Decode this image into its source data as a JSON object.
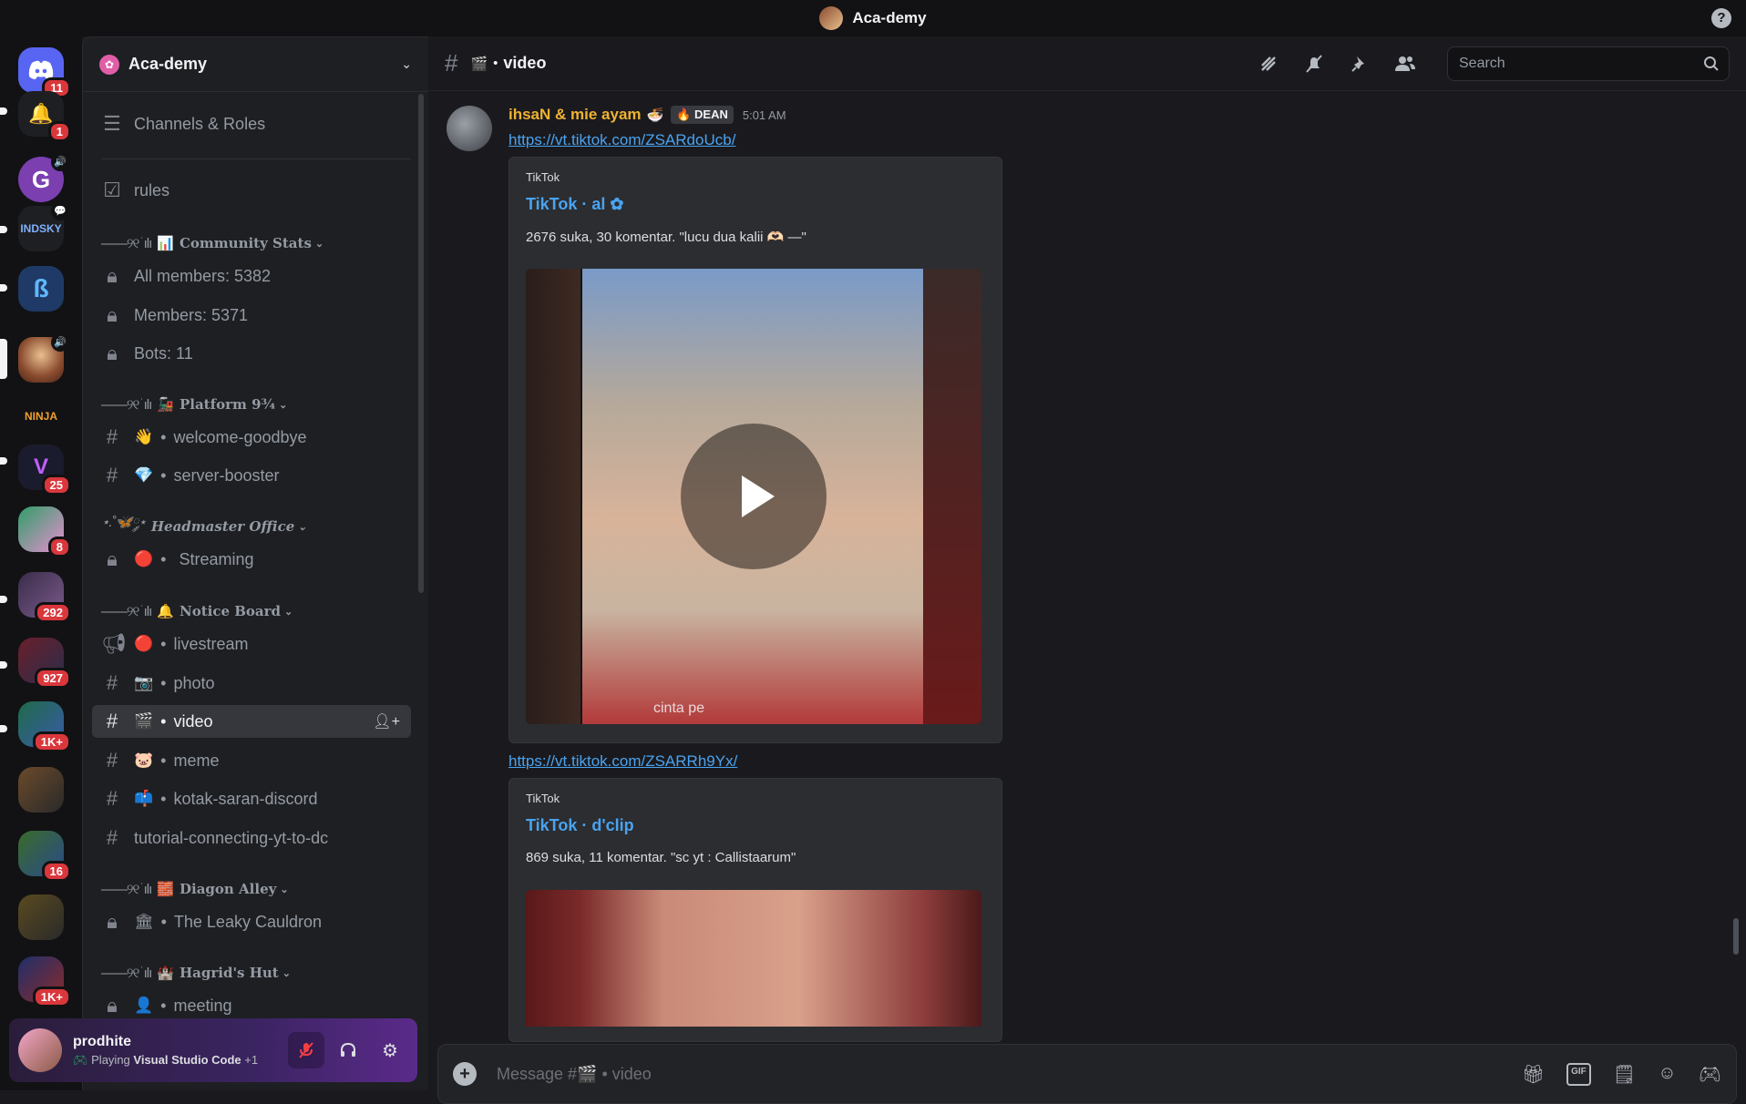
{
  "window": {
    "title": "Aca-demy",
    "help_icon": "?"
  },
  "rail": {
    "servers": [
      {
        "name": "discord-home",
        "badge": "11",
        "color": "#5865f2"
      },
      {
        "name": "notifications",
        "badge": "1",
        "color": "#2b2d31"
      },
      {
        "name": "server-g",
        "badge": "",
        "color": "#7b3fb0"
      },
      {
        "name": "server-indosky",
        "badge": "",
        "color": "#1e1f22"
      },
      {
        "name": "server-b",
        "badge": "",
        "color": "#1f3a66"
      },
      {
        "name": "server-aca-demy",
        "badge": "",
        "color": "#8a4b2f"
      },
      {
        "name": "server-ninja",
        "badge": "",
        "color": "#121214"
      },
      {
        "name": "server-v",
        "badge": "25",
        "color": "#1b1b2e"
      },
      {
        "name": "server-anime",
        "badge": "8",
        "color": "#2f9e68"
      },
      {
        "name": "folder-1",
        "badge": "292",
        "color": "#3a2d4a"
      },
      {
        "name": "folder-2",
        "badge": "927",
        "color": "#6a1f2b"
      },
      {
        "name": "folder-3",
        "badge": "1K+",
        "color": "#1f6b4a"
      },
      {
        "name": "folder-4",
        "badge": "",
        "color": "#6b4a2a"
      },
      {
        "name": "folder-5",
        "badge": "16",
        "color": "#3a6b2a"
      },
      {
        "name": "folder-6",
        "badge": "",
        "color": "#5a4a1f"
      },
      {
        "name": "folder-7",
        "badge": "1K+",
        "color": "#1f2f6b"
      },
      {
        "name": "folder-8",
        "badge": "",
        "color": "#6b3aa8"
      }
    ]
  },
  "sidebar": {
    "guild_name": "Aca-demy",
    "channels_roles": "Channels & Roles",
    "rules": "rules",
    "categories": {
      "community": {
        "ornament": "——୨୧ ׂ ılı",
        "emoji": "📊",
        "name": "Community Stats"
      },
      "platform": {
        "ornament": "——୨୧ ׂ ılı",
        "emoji": "🚂",
        "name": "Platform 9¾"
      },
      "headmaster": {
        "ornament": "⋆.˚🦋༘⋆",
        "emoji": "",
        "name": "Headmaster Office"
      },
      "notice": {
        "ornament": "——୨୧ ׂ ılı",
        "emoji": "🔔",
        "name": "Notice Board"
      },
      "diagon": {
        "ornament": "——୨୧ ׂ ılı",
        "emoji": "🧱",
        "name": "Diagon Alley"
      },
      "hagrid": {
        "ornament": "——୨୧ ׂ ılı",
        "emoji": "🏰",
        "name": "Hagrid's Hut"
      }
    },
    "channels": {
      "all_members": "All members: 5382",
      "members": "Members: 5371",
      "bots": "Bots: 11",
      "welcome": {
        "emoji": "👋",
        "name": "welcome-goodbye"
      },
      "booster": {
        "emoji": "💎",
        "name": "server-booster"
      },
      "streaming": {
        "emoji": "🔴",
        "name": "Streaming"
      },
      "livestream": {
        "emoji": "🔴",
        "name": "livestream"
      },
      "photo": {
        "emoji": "📷",
        "name": "photo"
      },
      "video": {
        "emoji": "🎬",
        "name": "video"
      },
      "meme": {
        "emoji": "🐷",
        "name": "meme"
      },
      "kotak": {
        "emoji": "📫",
        "name": "kotak-saran-discord"
      },
      "tutorial": "tutorial-connecting-yt-to-dc",
      "leaky": {
        "emoji": "🏛",
        "name": "The Leaky Cauldron"
      },
      "meeting": {
        "emoji": "👤",
        "name": "meeting"
      }
    },
    "dot": "•"
  },
  "user": {
    "name": "prodhite",
    "status_prefix": "Playing",
    "status_app": "Visual Studio Code",
    "status_suffix": "+1"
  },
  "header": {
    "channel_emoji": "🎬",
    "channel_name": "video",
    "search_placeholder": "Search"
  },
  "message": {
    "author": "ihsaN & mie ayam",
    "author_emoji": "🍜",
    "role": "DEAN",
    "role_emoji": "🔥",
    "time": "5:01 AM",
    "link1": "https://vt.tiktok.com/ZSARdoUcb/",
    "embed1": {
      "provider": "TikTok",
      "title": "TikTok · al",
      "title_emoji": "✿",
      "description": "2676 suka, 30 komentar. \"lucu dua kalii 🫶🏻 —\"",
      "caption": "cinta pe"
    },
    "link2": "https://vt.tiktok.com/ZSARRh9Yx/",
    "embed2": {
      "provider": "TikTok",
      "title": "TikTok · d'clip",
      "description": "869 suka, 11 komentar. \"sc yt : Callistaarum\""
    }
  },
  "composer": {
    "placeholder": "Message #🎬 • video"
  },
  "colors": {
    "accent": "#5865f2",
    "link": "#4aa3f0",
    "author": "#f0b232",
    "badge": "#da373c"
  }
}
